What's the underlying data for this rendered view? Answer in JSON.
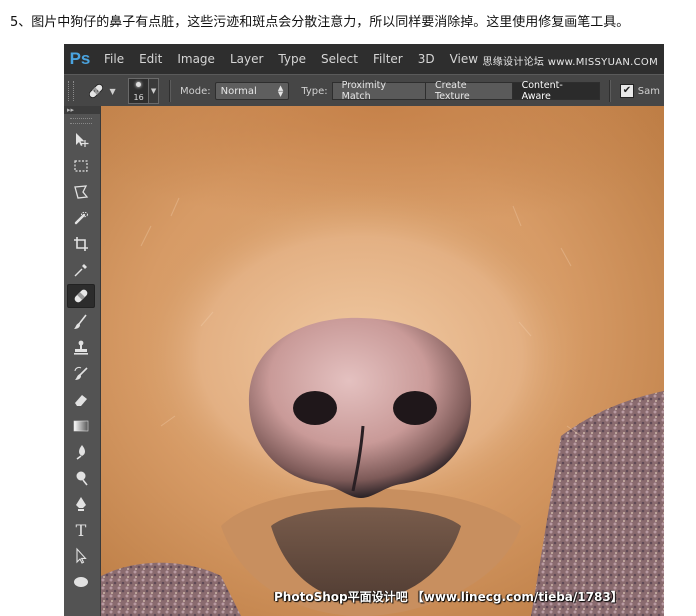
{
  "caption": "5、图片中狗仔的鼻子有点脏，这些污迹和斑点会分散注意力，所以同样要消除掉。这里使用修复画笔工具。",
  "app": {
    "logo": "Ps"
  },
  "menu": [
    "File",
    "Edit",
    "Image",
    "Layer",
    "Type",
    "Select",
    "Filter",
    "3D",
    "View"
  ],
  "watermark_top": "思缘设计论坛 www.MISSYUAN.COM",
  "options": {
    "tool_icon": "healing-brush-icon",
    "brush_size": "16",
    "mode_label": "Mode:",
    "mode_value": "Normal",
    "type_label": "Type:",
    "type_options": [
      "Proximity Match",
      "Create Texture",
      "Content-Aware"
    ],
    "type_selected": "Content-Aware",
    "sample_label": "Sam",
    "sample_checked": true
  },
  "toolbar": {
    "header": "▸▸",
    "tools": [
      "move-icon",
      "marquee-icon",
      "lasso-icon",
      "quick-selection-icon",
      "crop-icon",
      "eyedropper-icon",
      "healing-brush-icon",
      "brush-icon",
      "clone-stamp-icon",
      "history-brush-icon",
      "eraser-icon",
      "gradient-icon",
      "blur-icon",
      "dodge-icon",
      "pen-icon",
      "type-icon",
      "path-selection-icon",
      "ellipse-icon"
    ],
    "active_tool": "healing-brush-icon"
  },
  "watermark_bottom": "PhotoShop平面设计吧 【www.linecg.com/tieba/1783】"
}
